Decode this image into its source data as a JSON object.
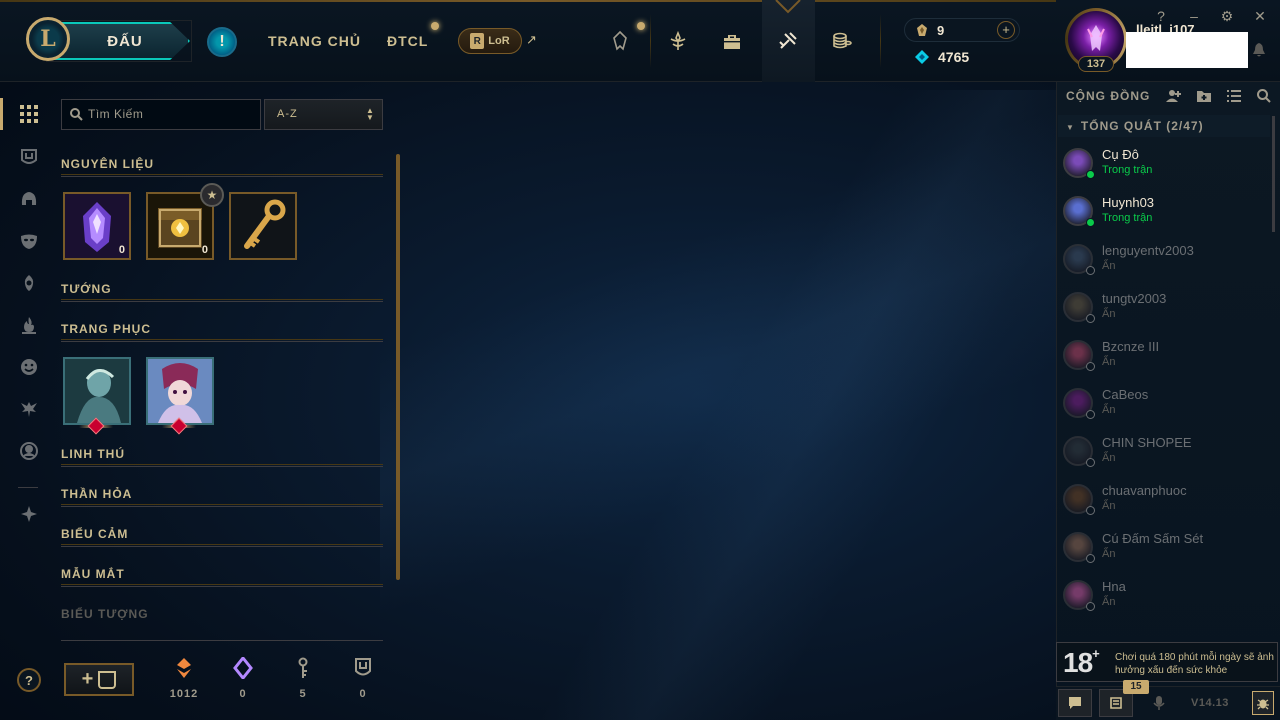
{
  "header": {
    "logo_letter": "L",
    "play_label": "ĐẤU",
    "alert_label": "!",
    "nav": [
      {
        "label": "TRANG CHỦ"
      },
      {
        "label": "ĐTCL"
      }
    ],
    "lor_label": "LoR",
    "lor_badge": "R",
    "external_arrow": "↗",
    "icons": [
      "profile-crest-icon",
      "rank-icon",
      "collection-icon",
      "loot-icon",
      "store-icon"
    ],
    "currency": {
      "rp_value": "9",
      "add_rp_label": "+",
      "be_value": "4765"
    },
    "profile": {
      "level": "137",
      "name_partial": "lleitl. i107"
    },
    "window_buttons": [
      "?",
      "–",
      "⚙",
      "✕"
    ]
  },
  "sidebar": {
    "items": [
      "grid-icon",
      "shield-icon",
      "helmet-icon",
      "mask-icon",
      "ward-icon",
      "emote-flame-icon",
      "smiley-icon",
      "little-legend-icon",
      "profile-icon-icon",
      "tft-icon"
    ],
    "help_label": "?"
  },
  "collection": {
    "search_placeholder": "Tìm Kiếm",
    "sort_value": "A-Z",
    "sections": [
      {
        "label": "NGUYÊN LIỆU"
      },
      {
        "label": "TƯỚNG"
      },
      {
        "label": "TRANG PHỤC"
      },
      {
        "label": "LINH THÚ"
      },
      {
        "label": "THẦN HỎA"
      },
      {
        "label": "BIỂU CẢM"
      },
      {
        "label": "MẪU MẮT"
      },
      {
        "label": "BIỂU TƯỢNG"
      }
    ],
    "materials": [
      {
        "name": "orb",
        "count": "0"
      },
      {
        "name": "chest",
        "count": "0"
      },
      {
        "name": "key"
      }
    ],
    "craft_plus": "+",
    "resources": [
      {
        "icon": "orange-essence-icon",
        "value": "1012",
        "color": "#f0883e"
      },
      {
        "icon": "mythic-essence-icon",
        "value": "0",
        "color": "#b388ff"
      },
      {
        "icon": "key-fragment-icon",
        "value": "5",
        "color": "#a09b8c"
      },
      {
        "icon": "shield-token-icon",
        "value": "0",
        "color": "#a09b8c"
      }
    ]
  },
  "social": {
    "title": "CỘNG ĐỒNG",
    "group_label": "TỔNG QUÁT (2/47)",
    "friends": [
      {
        "name": "Cụ Đô",
        "status": "Trong trận",
        "online": true,
        "color": "#7b4bb8"
      },
      {
        "name": "Huynh03",
        "status": "Trong trận",
        "online": true,
        "color": "#5a6fd0"
      },
      {
        "name": "lenguyentv2003",
        "status": "Ẩn",
        "online": false,
        "color": "#3b4d66"
      },
      {
        "name": "tungtv2003",
        "status": "Ẩn",
        "online": false,
        "color": "#5a5040"
      },
      {
        "name": "Bzcnze III",
        "status": "Ẩn",
        "online": false,
        "color": "#a04060"
      },
      {
        "name": "CaBeos",
        "status": "Ẩn",
        "online": false,
        "color": "#702080"
      },
      {
        "name": "CHIN SHOPEE",
        "status": "Ẩn",
        "online": false,
        "color": "#303840"
      },
      {
        "name": "chuavanphuoc",
        "status": "Ẩn",
        "online": false,
        "color": "#604028"
      },
      {
        "name": "Cú Đấm Sấm Sét",
        "status": "Ẩn",
        "online": false,
        "color": "#806050"
      },
      {
        "name": "Hna",
        "status": "Ẩn",
        "online": false,
        "color": "#b05090"
      }
    ],
    "age_rating": "18",
    "age_plus": "+",
    "age_warning": "Chơi quá 180 phút mỗi ngày sẽ ảnh hưởng xấu đến sức khỏe",
    "notification_count": "15",
    "version": "V14.13"
  }
}
